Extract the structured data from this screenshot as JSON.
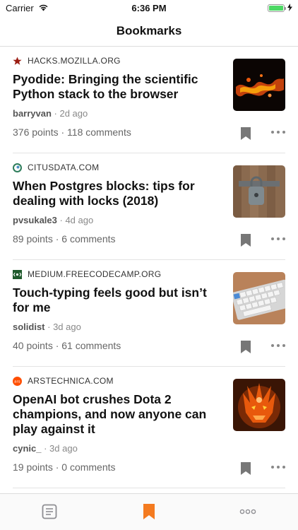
{
  "status_bar": {
    "carrier": "Carrier",
    "time": "6:36 PM",
    "icons": [
      "wifi-icon",
      "battery-icon",
      "charging-bolt-icon"
    ]
  },
  "nav": {
    "title": "Bookmarks"
  },
  "stories": [
    {
      "source": "HACKS.MOZILLA.ORG",
      "favicon": "mozilla-star-icon",
      "title": "Pyodide: Bringing the scientific Python stack to the browser",
      "author": "barryvan",
      "time": "· 2d ago",
      "stats": "376 points · 118 comments",
      "thumbnail": "fire-image"
    },
    {
      "source": "CITUSDATA.COM",
      "favicon": "citus-icon",
      "title": "When Postgres blocks: tips for dealing with locks (2018)",
      "author": "pvsukale3",
      "time": "· 4d ago",
      "stats": "89 points · 6 comments",
      "thumbnail": "padlock-image"
    },
    {
      "source": "MEDIUM.FREECODECAMP.ORG",
      "favicon": "freecodecamp-icon",
      "title": "Touch-typing feels good but isn’t for me",
      "author": "solidist",
      "time": "· 3d ago",
      "stats": "40 points · 61 comments",
      "thumbnail": "keyboard-image"
    },
    {
      "source": "ARSTECHNICA.COM",
      "favicon": "arstechnica-icon",
      "title": "OpenAI bot crushes Dota 2 champions, and now anyone can play against it",
      "author": "cynic_",
      "time": "· 3d ago",
      "stats": "19 points · 0 comments",
      "thumbnail": "dota-demon-image"
    }
  ],
  "tabbar": {
    "tabs": [
      {
        "icon": "stories-icon",
        "active": false
      },
      {
        "icon": "bookmark-icon",
        "active": true
      },
      {
        "icon": "more-icon",
        "active": false
      }
    ],
    "active_color": "#f47b20",
    "inactive_color": "#8e8e93"
  },
  "colors": {
    "bookmark_icon": "#777777"
  }
}
